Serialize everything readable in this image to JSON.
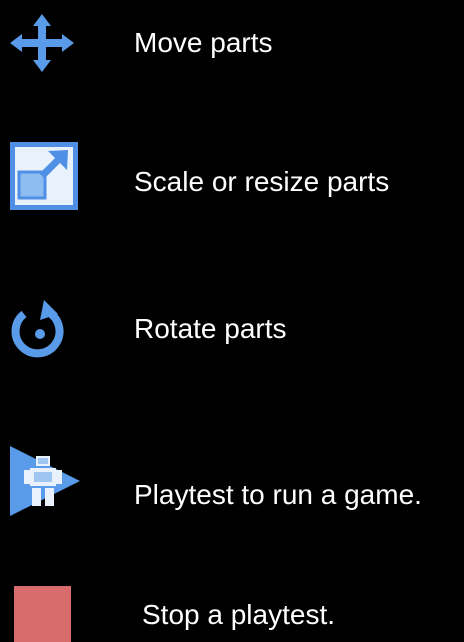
{
  "items": [
    {
      "icon": "move-icon",
      "label": "Move parts"
    },
    {
      "icon": "scale-icon",
      "label": "Scale or resize parts"
    },
    {
      "icon": "rotate-icon",
      "label": "Rotate parts"
    },
    {
      "icon": "playtest-icon",
      "label": "Playtest to run a game."
    },
    {
      "icon": "stop-icon",
      "label": "Stop a playtest."
    }
  ],
  "colors": {
    "background": "#000000",
    "text": "#ffffff",
    "tool_blue": "#4f8fe6",
    "tool_blue_light": "#9fc6f2",
    "stop_red": "#d86b6b"
  }
}
